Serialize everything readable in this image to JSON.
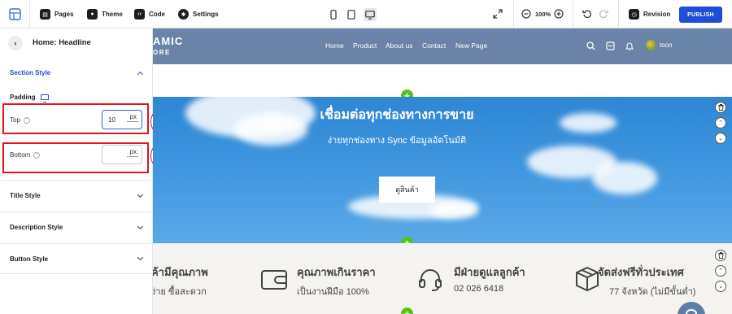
{
  "toolbar": {
    "pages_label": "Pages",
    "theme_label": "Theme",
    "code_label": "Code",
    "settings_label": "Settings",
    "zoom_level": "100%",
    "revision_label": "Revision",
    "publish_label": "PUBLISH"
  },
  "panel": {
    "title": "Home: Headline",
    "section_style": "Section Style",
    "padding_label": "Padding",
    "top_label": "Top",
    "top_value": "10",
    "top_unit": "px",
    "bottom_label": "Bottom",
    "bottom_value": "",
    "bottom_unit": "px",
    "step_top": "4",
    "step_bottom": "5",
    "sections": [
      "Title Style",
      "Description Style",
      "Button Style"
    ]
  },
  "site": {
    "logo_line1": "AMIC",
    "logo_line2": "ORE",
    "menu": [
      "Home",
      "Product",
      "About us",
      "Contact",
      "New Page"
    ],
    "user_name": "toon",
    "hero_title": "เชื่อมต่อทุกช่องทางการขาย",
    "hero_subtitle": "ง่ายทุกช่องทาง Sync ข้อมูลอัตโนมัติ",
    "hero_button": "ดูสินค้า",
    "features": [
      {
        "title": "ค้ามีคุณภาพ",
        "subtitle": "ง่าย ซื้อสะดวก"
      },
      {
        "title": "คุณภาพเกินราคา",
        "subtitle": "เป็นงานฝีมือ 100%"
      },
      {
        "title": "มีฝ่ายดูแลลูกค้า",
        "subtitle": "02 026 6418"
      },
      {
        "title": "จัดส่งฟรีทั่วประเทศ",
        "subtitle": "77 จังหวัด (ไม่มีขั้นต่ำ)"
      }
    ]
  },
  "colors": {
    "accent": "#1f4fd8",
    "highlight": "#e3121b",
    "nav_bg": "#6a83a8",
    "add_button": "#52c41a"
  }
}
